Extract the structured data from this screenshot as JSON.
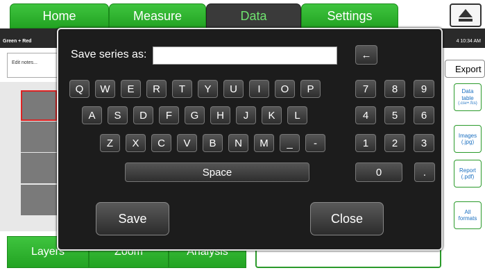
{
  "tabs": [
    "Home",
    "Measure",
    "Data",
    "Settings"
  ],
  "active_tab": "Data",
  "status": {
    "left": "Green + Red",
    "right": "4 10:34 AM"
  },
  "notes_placeholder": "Edit notes...",
  "export": {
    "label": "Export",
    "items": [
      {
        "l1": "Data",
        "l2": "table",
        "l3": "(.csv+.fcs)"
      },
      {
        "l1": "Images",
        "l2": "(.jpg)",
        "l3": ""
      },
      {
        "l1": "Report",
        "l2": "(.pdf)",
        "l3": ""
      },
      {
        "l1": "All",
        "l2": "formats",
        "l3": ""
      }
    ]
  },
  "bottom_tabs": [
    "Layers",
    "Zoom",
    "Analysis"
  ],
  "dialog": {
    "prompt": "Save series as:",
    "input_value": "",
    "backspace": "←",
    "letter_rows": [
      [
        "Q",
        "W",
        "E",
        "R",
        "T",
        "Y",
        "U",
        "I",
        "O",
        "P"
      ],
      [
        "A",
        "S",
        "D",
        "F",
        "G",
        "H",
        "J",
        "K",
        "L"
      ],
      [
        "Z",
        "X",
        "C",
        "V",
        "B",
        "N",
        "M",
        "_",
        "-"
      ]
    ],
    "space_label": "Space",
    "numpad_rows": [
      [
        "7",
        "8",
        "9"
      ],
      [
        "4",
        "5",
        "6"
      ],
      [
        "1",
        "2",
        "3"
      ]
    ],
    "zero": "0",
    "dot": ".",
    "save_label": "Save",
    "close_label": "Close"
  }
}
